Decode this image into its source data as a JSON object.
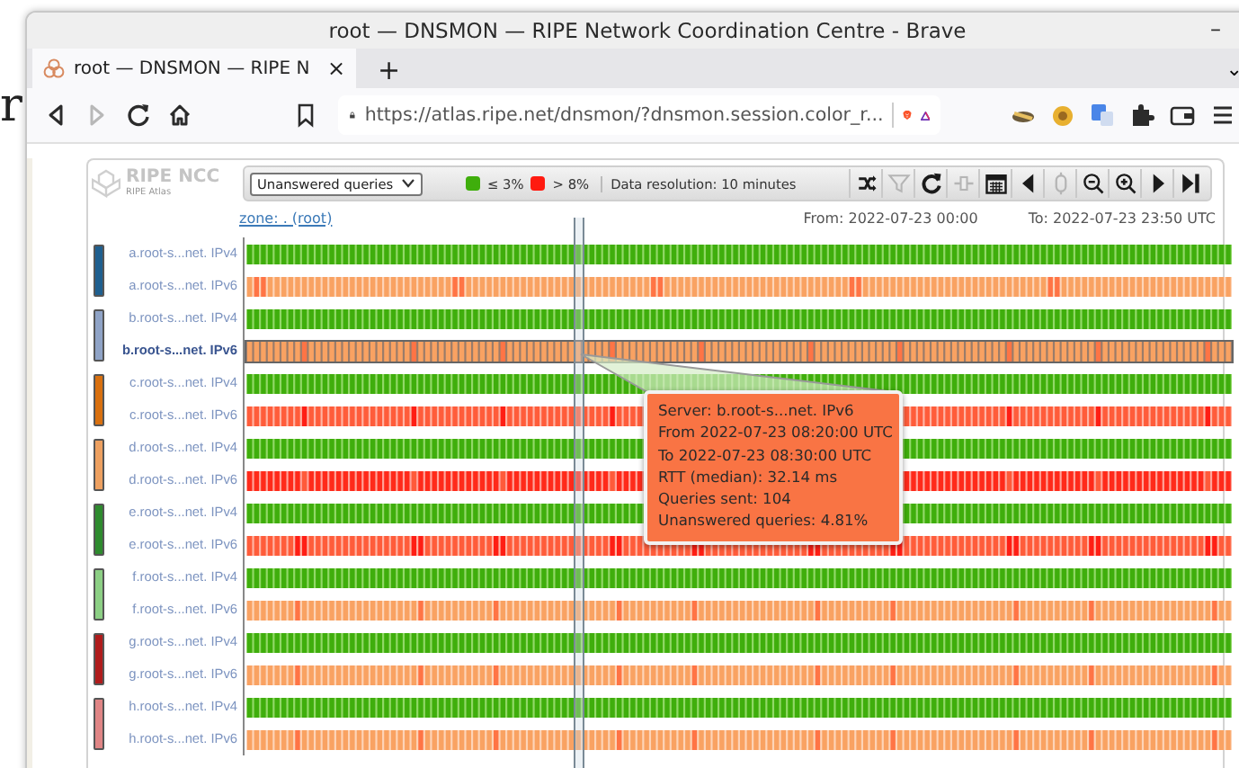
{
  "desktop": {
    "text": "r"
  },
  "window": {
    "title": "root — DNSMON — RIPE Network Coordination Centre - Brave",
    "minimize": "–"
  },
  "tabs": [
    {
      "label": "root — DNSMON — RIPE N",
      "selected": true,
      "close": "×"
    }
  ],
  "new_tab": "+",
  "tab_list": "⌄",
  "nav_buttons": [
    {
      "kind": "back",
      "disabled": false
    },
    {
      "kind": "forward",
      "disabled": true
    },
    {
      "kind": "reload",
      "disabled": false
    },
    {
      "kind": "home",
      "disabled": false
    }
  ],
  "address": {
    "value": "https://atlas.ripe.net/dnsmon/?dnsmon.session.color_r..."
  },
  "logo": {
    "name": "RIPE NCC",
    "sub": "RIPE Atlas"
  },
  "metric_select": {
    "value": "Unanswered queries"
  },
  "legend": [
    {
      "color": "#3fae0c",
      "label": "≤ 3%"
    },
    {
      "color": "#ff1a10",
      "label": "> 8%"
    }
  ],
  "resolution": "Data resolution: 10 minutes",
  "tools": [
    {
      "kind": "shuffle",
      "disabled": false
    },
    {
      "kind": "filter",
      "disabled": true
    },
    {
      "kind": "reload",
      "disabled": false
    },
    {
      "kind": "slider",
      "disabled": true
    },
    {
      "kind": "calendar",
      "disabled": false
    },
    {
      "kind": "left",
      "disabled": false
    },
    {
      "kind": "zoom-reset",
      "disabled": true
    },
    {
      "kind": "zoom-out",
      "disabled": false
    },
    {
      "kind": "zoom-in",
      "disabled": false
    },
    {
      "kind": "right",
      "disabled": false
    },
    {
      "kind": "end",
      "disabled": false
    }
  ],
  "zone": "zone: . (root)",
  "from": "From: 2022-07-23 00:00",
  "to": "To: 2022-07-23 23:50 UTC",
  "servers": [
    {
      "color": "#1f5f8f",
      "rows": [
        {
          "label": "a.root-s...net. IPv4",
          "kind": "good",
          "selected": false
        },
        {
          "label": "a.root-s...net. IPv6",
          "kind": "warning",
          "selected": false
        }
      ]
    },
    {
      "color": "#8fa3c6",
      "rows": [
        {
          "label": "b.root-s...net. IPv4",
          "kind": "good",
          "selected": false
        },
        {
          "label": "b.root-s...net. IPv6",
          "kind": "warning",
          "selected": true
        }
      ]
    },
    {
      "color": "#d9700f",
      "rows": [
        {
          "label": "c.root-s...net. IPv4",
          "kind": "good",
          "selected": false
        },
        {
          "label": "c.root-s...net. IPv6",
          "kind": "bad",
          "selected": false
        }
      ]
    },
    {
      "color": "#eda060",
      "rows": [
        {
          "label": "d.root-s...net. IPv4",
          "kind": "good",
          "selected": false
        },
        {
          "label": "d.root-s...net. IPv6",
          "kind": "critical",
          "selected": false
        }
      ]
    },
    {
      "color": "#2e8b2e",
      "rows": [
        {
          "label": "e.root-s...net. IPv4",
          "kind": "good",
          "selected": false
        },
        {
          "label": "e.root-s...net. IPv6",
          "kind": "bad",
          "selected": false
        }
      ]
    },
    {
      "color": "#8ccf84",
      "rows": [
        {
          "label": "f.root-s...net. IPv4",
          "kind": "good",
          "selected": false
        },
        {
          "label": "f.root-s...net. IPv6",
          "kind": "warning",
          "selected": false
        }
      ]
    },
    {
      "color": "#b01c1c",
      "rows": [
        {
          "label": "g.root-s...net. IPv4",
          "kind": "good",
          "selected": false
        },
        {
          "label": "g.root-s...net. IPv6",
          "kind": "warning",
          "selected": false
        }
      ]
    },
    {
      "color": "#e08585",
      "rows": [
        {
          "label": "h.root-s...net. IPv4",
          "kind": "good",
          "selected": false
        },
        {
          "label": "h.root-s...net. IPv6",
          "kind": "warning",
          "selected": false
        }
      ]
    }
  ],
  "tooltip": [
    "Server: b.root-s...net. IPv6",
    "From 2022-07-23 08:20:00 UTC",
    "To 2022-07-23 08:30:00 UTC",
    "RTT (median): 32.14 ms",
    "Queries sent: 104",
    "Unanswered queries: 4.81%"
  ]
}
